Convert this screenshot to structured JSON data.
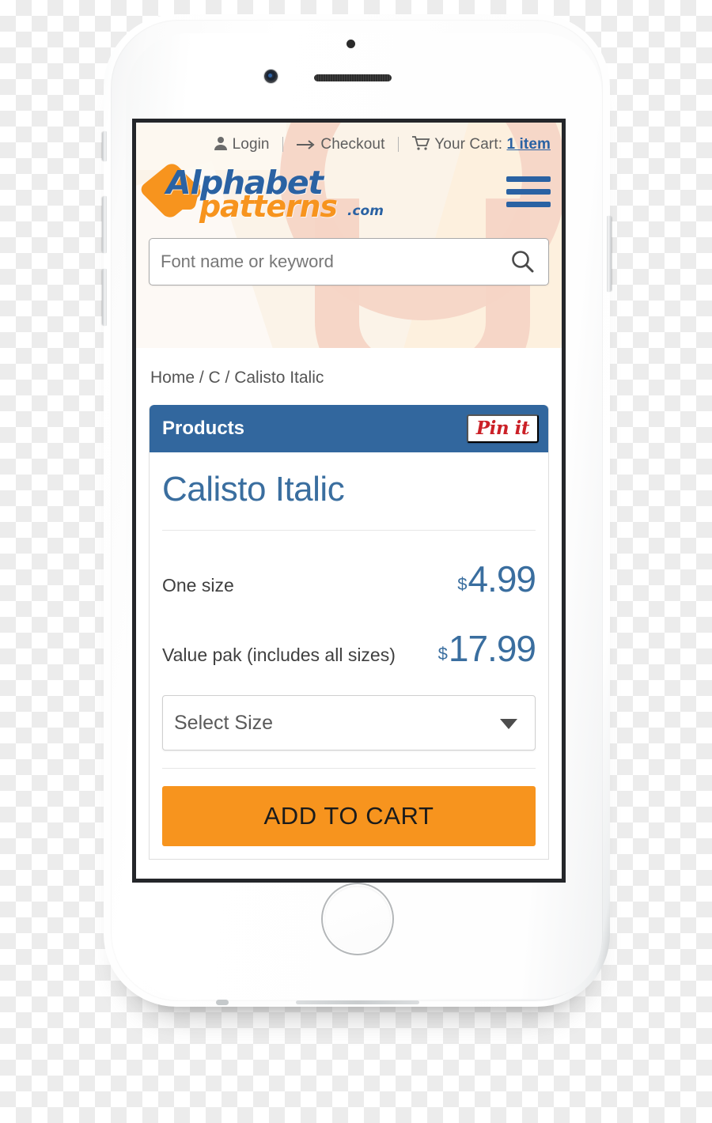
{
  "device": {
    "type": "white-smartphone",
    "hardware": {
      "front_camera": "front-camera",
      "earpiece": "earpiece-speaker",
      "sensor": "proximity-sensor",
      "home_button": "home-button",
      "volume_up": "volume-up-button",
      "volume_down": "volume-down-button",
      "mute_switch": "mute-switch",
      "power": "power-button"
    }
  },
  "site": {
    "utility_bar": {
      "login": "Login",
      "checkout": "Checkout",
      "cart_label": "Your Cart:",
      "cart_count": "1 item",
      "separator": "|"
    },
    "logo": {
      "word1": "Alphabet",
      "word2": "patterns",
      "tld": ".com",
      "colors": {
        "blue": "#2a62a3",
        "orange": "#f7941e"
      }
    },
    "menu_button": "hamburger-menu",
    "search": {
      "placeholder": "Font name or keyword",
      "value": "",
      "icon": "search-icon"
    },
    "header_bg": "#fbf3e8"
  },
  "breadcrumb": {
    "text": "Home / C / Calisto Italic",
    "items": [
      "Home",
      "C",
      "Calisto Italic"
    ],
    "separator": "/"
  },
  "card": {
    "header_title": "Products",
    "header_color": "#32679e",
    "pin_button": "Pin it",
    "pin_color": "#cb2027"
  },
  "product": {
    "name": "Calisto Italic",
    "name_color": "#3a6e9f",
    "options": [
      {
        "label": "One size",
        "currency": "$",
        "price": "4.99"
      },
      {
        "label": "Value pak (includes all sizes)",
        "currency": "$",
        "price": "17.99"
      }
    ],
    "size_select": {
      "selected": "Select Size",
      "icon": "chevron-down-icon"
    },
    "add_to_cart": "ADD TO CART",
    "add_to_cart_color": "#f7941e"
  }
}
